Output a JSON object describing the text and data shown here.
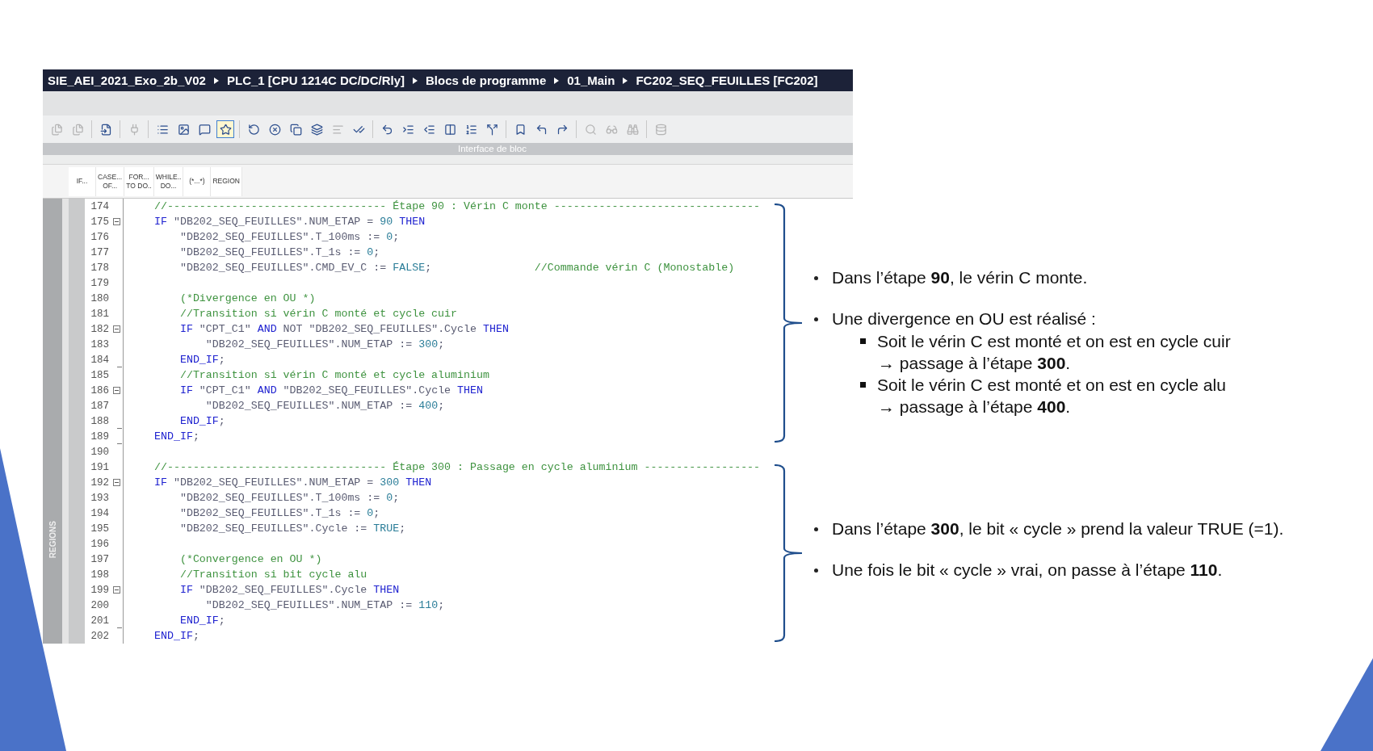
{
  "breadcrumb": [
    "SIE_AEI_2021_Exo_2b_V02",
    "PLC_1 [CPU 1214C DC/DC/Rly]",
    "Blocs de programme",
    "01_Main",
    "FC202_SEQ_FEUILLES [FC202]"
  ],
  "toolbar_groups": [
    [
      {
        "disabled": true,
        "selected": false
      },
      {
        "disabled": true,
        "selected": false
      }
    ],
    [
      {
        "disabled": false,
        "selected": false
      }
    ],
    [
      {
        "disabled": true,
        "selected": false
      }
    ],
    [
      {
        "disabled": false,
        "selected": false
      },
      {
        "disabled": false,
        "selected": false
      },
      {
        "disabled": false,
        "selected": false
      },
      {
        "disabled": false,
        "selected": true
      }
    ],
    [
      {
        "disabled": false,
        "selected": false
      },
      {
        "disabled": false,
        "selected": false
      },
      {
        "disabled": false,
        "selected": false
      },
      {
        "disabled": false,
        "selected": false
      },
      {
        "disabled": true,
        "selected": false
      },
      {
        "disabled": false,
        "selected": false
      }
    ],
    [
      {
        "disabled": false,
        "selected": false
      },
      {
        "disabled": false,
        "selected": false
      },
      {
        "disabled": false,
        "selected": false
      },
      {
        "disabled": false,
        "selected": false
      },
      {
        "disabled": false,
        "selected": false
      },
      {
        "disabled": false,
        "selected": false
      }
    ],
    [
      {
        "disabled": false,
        "selected": false
      },
      {
        "disabled": false,
        "selected": false
      },
      {
        "disabled": false,
        "selected": false
      }
    ],
    [
      {
        "disabled": true,
        "selected": false
      },
      {
        "disabled": true,
        "selected": false
      },
      {
        "disabled": true,
        "selected": false
      }
    ],
    [
      {
        "disabled": true,
        "selected": false
      }
    ]
  ],
  "interface_bar": "Interface de bloc",
  "snippets": [
    [
      "IF..."
    ],
    [
      "CASE...",
      "OF..."
    ],
    [
      "FOR...",
      "TO DO.."
    ],
    [
      "WHILE..",
      "DO..."
    ],
    [
      "(*...*)"
    ],
    [
      "REGION"
    ]
  ],
  "regions_label": "REGIONS",
  "code_sections": [
    {
      "braced": true,
      "lines": [
        {
          "n": "174",
          "collapsible": false,
          "fold_end": false,
          "parts": [
            {
              "kind": "comment",
              "t": "//---------------------------------- Étape 90 : Vérin C monte --------------------------------"
            }
          ]
        },
        {
          "n": "175",
          "collapsible": true,
          "fold_end": false,
          "parts": [
            {
              "kind": "keyword",
              "t": "IF"
            },
            {
              "kind": "plain",
              "t": " \"DB202_SEQ_FEUILLES\".NUM_ETAP = "
            },
            {
              "kind": "literal",
              "t": "90 "
            },
            {
              "kind": "keyword",
              "t": "THEN"
            }
          ]
        },
        {
          "n": "176",
          "collapsible": false,
          "fold_end": false,
          "parts": [
            {
              "kind": "plain",
              "t": "    \"DB202_SEQ_FEUILLES\".T_100ms := "
            },
            {
              "kind": "literal",
              "t": "0"
            },
            {
              "kind": "plain",
              "t": ";"
            }
          ]
        },
        {
          "n": "177",
          "collapsible": false,
          "fold_end": false,
          "parts": [
            {
              "kind": "plain",
              "t": "    \"DB202_SEQ_FEUILLES\".T_1s := "
            },
            {
              "kind": "literal",
              "t": "0"
            },
            {
              "kind": "plain",
              "t": ";"
            }
          ]
        },
        {
          "n": "178",
          "collapsible": false,
          "fold_end": false,
          "parts": [
            {
              "kind": "plain",
              "t": "    \"DB202_SEQ_FEUILLES\".CMD_EV_C := "
            },
            {
              "kind": "literal",
              "t": "FALSE"
            },
            {
              "kind": "plain",
              "t": ";                "
            },
            {
              "kind": "comment",
              "t": "//Commande vérin C (Monostable)"
            }
          ]
        },
        {
          "n": "179",
          "collapsible": false,
          "fold_end": false
        },
        {
          "n": "180",
          "collapsible": false,
          "fold_end": false,
          "parts": [
            {
              "kind": "comment",
              "t": "    (*Divergence en OU *)"
            }
          ]
        },
        {
          "n": "181",
          "collapsible": false,
          "fold_end": false,
          "parts": [
            {
              "kind": "comment",
              "t": "    //Transition si vérin C monté et cycle cuir"
            }
          ]
        },
        {
          "n": "182",
          "collapsible": true,
          "fold_end": false,
          "parts": [
            {
              "kind": "keyword",
              "t": "    IF"
            },
            {
              "kind": "plain",
              "t": " \"CPT_C1\" "
            },
            {
              "kind": "keyword",
              "t": "AND"
            },
            {
              "kind": "plain",
              "t": " NOT \"DB202_SEQ_FEUILLES\".Cycle "
            },
            {
              "kind": "keyword",
              "t": "THEN"
            }
          ]
        },
        {
          "n": "183",
          "collapsible": false,
          "fold_end": false,
          "parts": [
            {
              "kind": "plain",
              "t": "        \"DB202_SEQ_FEUILLES\".NUM_ETAP := "
            },
            {
              "kind": "literal",
              "t": "300"
            },
            {
              "kind": "plain",
              "t": ";"
            }
          ]
        },
        {
          "n": "184",
          "collapsible": false,
          "fold_end": true,
          "parts": [
            {
              "kind": "keyword",
              "t": "    END_IF"
            },
            {
              "kind": "plain",
              "t": ";"
            }
          ]
        },
        {
          "n": "185",
          "collapsible": false,
          "fold_end": false,
          "parts": [
            {
              "kind": "comment",
              "t": "    //Transition si vérin C monté et cycle aluminium"
            }
          ]
        },
        {
          "n": "186",
          "collapsible": true,
          "fold_end": false,
          "parts": [
            {
              "kind": "keyword",
              "t": "    IF"
            },
            {
              "kind": "plain",
              "t": " \"CPT_C1\" "
            },
            {
              "kind": "keyword",
              "t": "AND"
            },
            {
              "kind": "plain",
              "t": " \"DB202_SEQ_FEUILLES\".Cycle "
            },
            {
              "kind": "keyword",
              "t": "THEN"
            }
          ]
        },
        {
          "n": "187",
          "collapsible": false,
          "fold_end": false,
          "parts": [
            {
              "kind": "plain",
              "t": "        \"DB202_SEQ_FEUILLES\".NUM_ETAP := "
            },
            {
              "kind": "literal",
              "t": "400"
            },
            {
              "kind": "plain",
              "t": ";"
            }
          ]
        },
        {
          "n": "188",
          "collapsible": false,
          "fold_end": true,
          "parts": [
            {
              "kind": "keyword",
              "t": "    END_IF"
            },
            {
              "kind": "plain",
              "t": ";"
            }
          ]
        },
        {
          "n": "189",
          "collapsible": false,
          "fold_end": true,
          "parts": [
            {
              "kind": "keyword",
              "t": "END_IF"
            },
            {
              "kind": "plain",
              "t": ";"
            }
          ]
        }
      ]
    },
    {
      "braced": false,
      "lines": [
        {
          "n": "190",
          "collapsible": false,
          "fold_end": false
        }
      ]
    },
    {
      "braced": true,
      "lines": [
        {
          "n": "191",
          "collapsible": false,
          "fold_end": false,
          "parts": [
            {
              "kind": "comment",
              "t": "//---------------------------------- Étape 300 : Passage en cycle aluminium ------------------"
            }
          ]
        },
        {
          "n": "192",
          "collapsible": true,
          "fold_end": false,
          "parts": [
            {
              "kind": "keyword",
              "t": "IF"
            },
            {
              "kind": "plain",
              "t": " \"DB202_SEQ_FEUILLES\".NUM_ETAP = "
            },
            {
              "kind": "literal",
              "t": "300 "
            },
            {
              "kind": "keyword",
              "t": "THEN"
            }
          ]
        },
        {
          "n": "193",
          "collapsible": false,
          "fold_end": false,
          "parts": [
            {
              "kind": "plain",
              "t": "    \"DB202_SEQ_FEUILLES\".T_100ms := "
            },
            {
              "kind": "literal",
              "t": "0"
            },
            {
              "kind": "plain",
              "t": ";"
            }
          ]
        },
        {
          "n": "194",
          "collapsible": false,
          "fold_end": false,
          "parts": [
            {
              "kind": "plain",
              "t": "    \"DB202_SEQ_FEUILLES\".T_1s := "
            },
            {
              "kind": "literal",
              "t": "0"
            },
            {
              "kind": "plain",
              "t": ";"
            }
          ]
        },
        {
          "n": "195",
          "collapsible": false,
          "fold_end": false,
          "parts": [
            {
              "kind": "plain",
              "t": "    \"DB202_SEQ_FEUILLES\".Cycle := "
            },
            {
              "kind": "literal",
              "t": "TRUE"
            },
            {
              "kind": "plain",
              "t": ";"
            }
          ]
        },
        {
          "n": "196",
          "collapsible": false,
          "fold_end": false
        },
        {
          "n": "197",
          "collapsible": false,
          "fold_end": false,
          "parts": [
            {
              "kind": "comment",
              "t": "    (*Convergence en OU *)"
            }
          ]
        },
        {
          "n": "198",
          "collapsible": false,
          "fold_end": false,
          "parts": [
            {
              "kind": "comment",
              "t": "    //Transition si bit cycle alu"
            }
          ]
        },
        {
          "n": "199",
          "collapsible": true,
          "fold_end": false,
          "parts": [
            {
              "kind": "keyword",
              "t": "    IF"
            },
            {
              "kind": "plain",
              "t": " \"DB202_SEQ_FEUILLES\".Cycle "
            },
            {
              "kind": "keyword",
              "t": "THEN"
            }
          ]
        },
        {
          "n": "200",
          "collapsible": false,
          "fold_end": false,
          "parts": [
            {
              "kind": "plain",
              "t": "        \"DB202_SEQ_FEUILLES\".NUM_ETAP := "
            },
            {
              "kind": "literal",
              "t": "110"
            },
            {
              "kind": "plain",
              "t": ";"
            }
          ]
        },
        {
          "n": "201",
          "collapsible": false,
          "fold_end": true,
          "parts": [
            {
              "kind": "keyword",
              "t": "    END_IF"
            },
            {
              "kind": "plain",
              "t": ";"
            }
          ]
        },
        {
          "n": "202",
          "collapsible": false,
          "fold_end": false,
          "parts": [
            {
              "kind": "keyword",
              "t": "END_IF"
            },
            {
              "kind": "plain",
              "t": ";"
            }
          ]
        }
      ]
    }
  ],
  "notes": [
    {
      "items": [
        {
          "text": "Dans l’étape **90**, le vérin C monte."
        },
        {
          "text": "Une divergence en OU est réalisé :",
          "children": [
            {
              "lines": [
                "Soit le vérin C est monté et on est en cycle cuir",
                "→ passage à l’étape **300**."
              ]
            },
            {
              "lines": [
                "Soit le vérin C est monté et on est en cycle alu",
                "→ passage à l’étape **400**."
              ]
            }
          ]
        }
      ]
    },
    {
      "items": [
        {
          "text": "Dans l’étape **300**, le bit « cycle » prend la valeur TRUE (=1)."
        },
        {
          "text": "Une fois le bit « cycle » vrai, on passe à l’étape **110**."
        }
      ]
    }
  ]
}
